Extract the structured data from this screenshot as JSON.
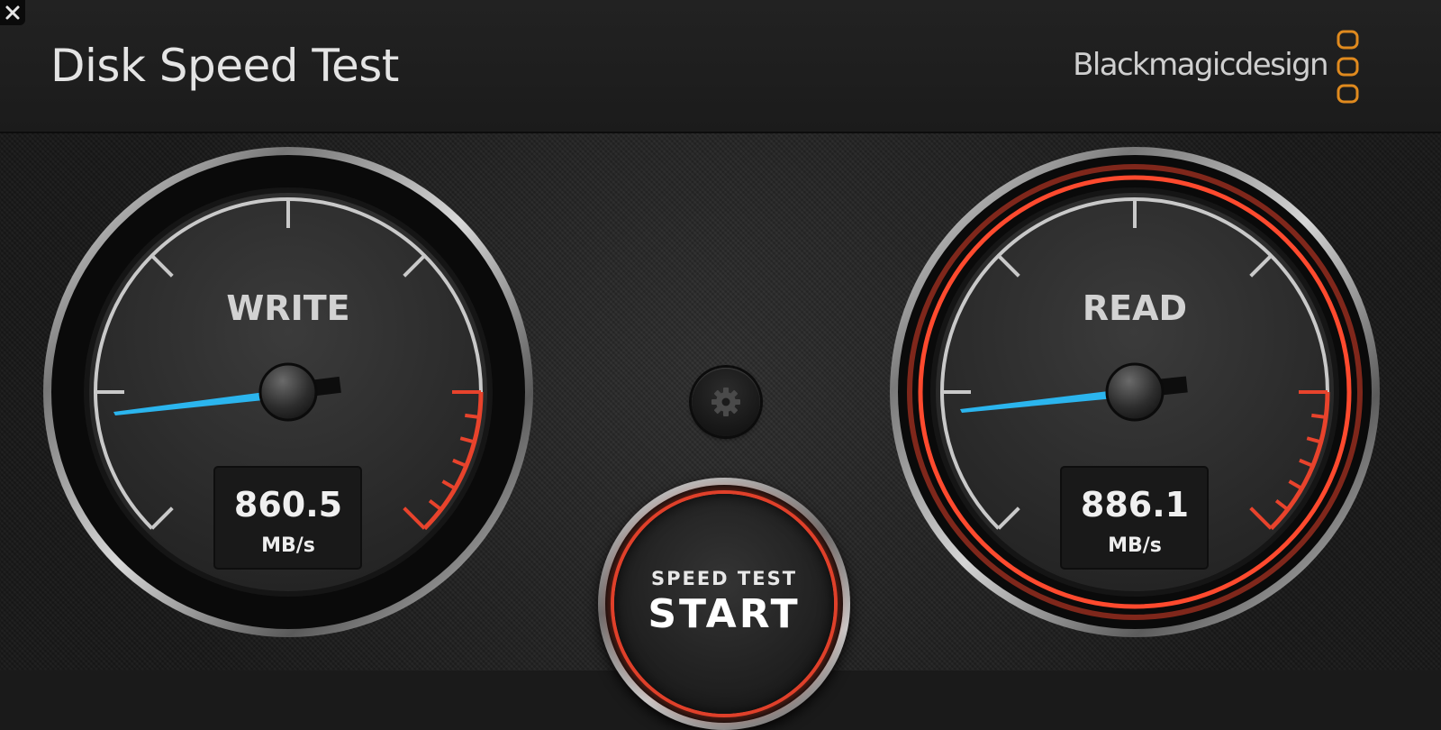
{
  "window": {
    "close_icon": "close-x-icon",
    "title": "Disk Speed Test"
  },
  "brand": {
    "name": "Blackmagicdesign",
    "logo_icon": "blackmagic-logo-icon",
    "logo_color": "#e08a1e"
  },
  "write_gauge": {
    "label": "WRITE",
    "value": "860.5",
    "unit": "MB/s",
    "needle_color": "#2bb5ee",
    "state": "idle"
  },
  "read_gauge": {
    "label": "READ",
    "value": "886.1",
    "unit": "MB/s",
    "needle_color": "#2bb5ee",
    "state": "active",
    "ring_color": "#e0402a"
  },
  "settings": {
    "icon": "gear-icon"
  },
  "start_button": {
    "top_label": "SPEED TEST",
    "main_label": "START"
  }
}
